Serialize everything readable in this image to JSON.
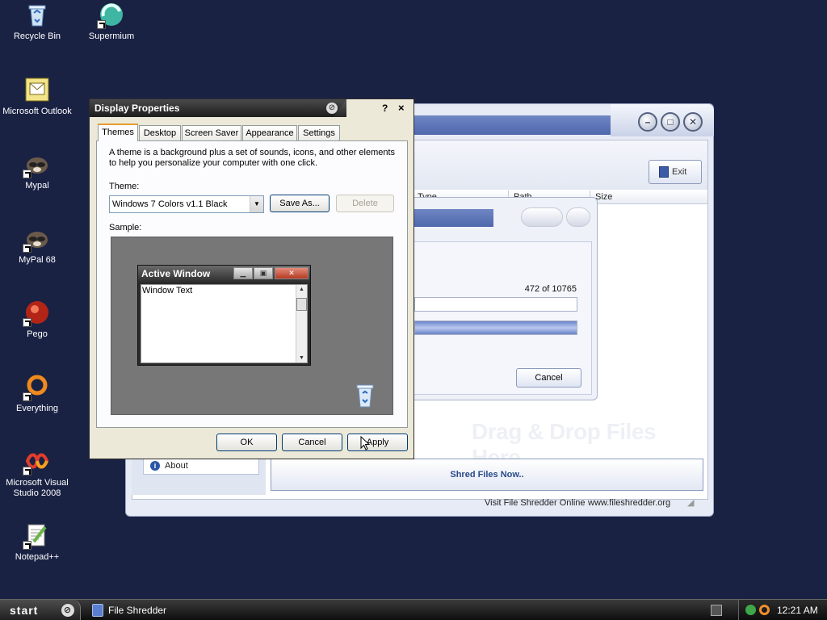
{
  "desktop": {
    "icons": [
      {
        "label": "Recycle Bin"
      },
      {
        "label": "Supermium"
      },
      {
        "label": "Microsoft Outlook"
      },
      {
        "label": "Mypal"
      },
      {
        "label": "MyPal 68"
      },
      {
        "label": "Pego"
      },
      {
        "label": "Everything"
      },
      {
        "label": "Microsoft Visual Studio 2008"
      },
      {
        "label": "Notepad++"
      }
    ]
  },
  "file_shredder": {
    "exit_label": "Exit",
    "columns": [
      "Type",
      "Path",
      "Size"
    ],
    "dropzone_text": "Drag & Drop Files Here",
    "about_label": "About",
    "shred_label": "Shred Files Now..",
    "status_left": "Visit File Shredder Online",
    "status_right": "www.fileshredder.org"
  },
  "progress_dialog": {
    "count_text": "472  of  10765",
    "bar1_fraction": 0.0,
    "bar2_fraction": 1.0,
    "cancel_label": "Cancel"
  },
  "display_properties": {
    "title": "Display Properties",
    "help": "?",
    "close": "×",
    "tabs": [
      "Themes",
      "Desktop",
      "Screen Saver",
      "Appearance",
      "Settings"
    ],
    "description": "A theme is a background plus a set of sounds, icons, and other elements to help you personalize your computer with one click.",
    "theme_label": "Theme:",
    "theme_value": "Windows 7 Colors v1.1 Black",
    "save_as_label": "Save As...",
    "delete_label": "Delete",
    "sample_label": "Sample:",
    "sample_window": {
      "title": "Active Window",
      "body_text": "Window Text"
    },
    "ok_label": "OK",
    "cancel_label": "Cancel",
    "apply_label": "Apply"
  },
  "taskbar": {
    "start_label": "start",
    "tasks": [
      {
        "label": "File Shredder"
      }
    ],
    "clock": "12:21 AM"
  }
}
